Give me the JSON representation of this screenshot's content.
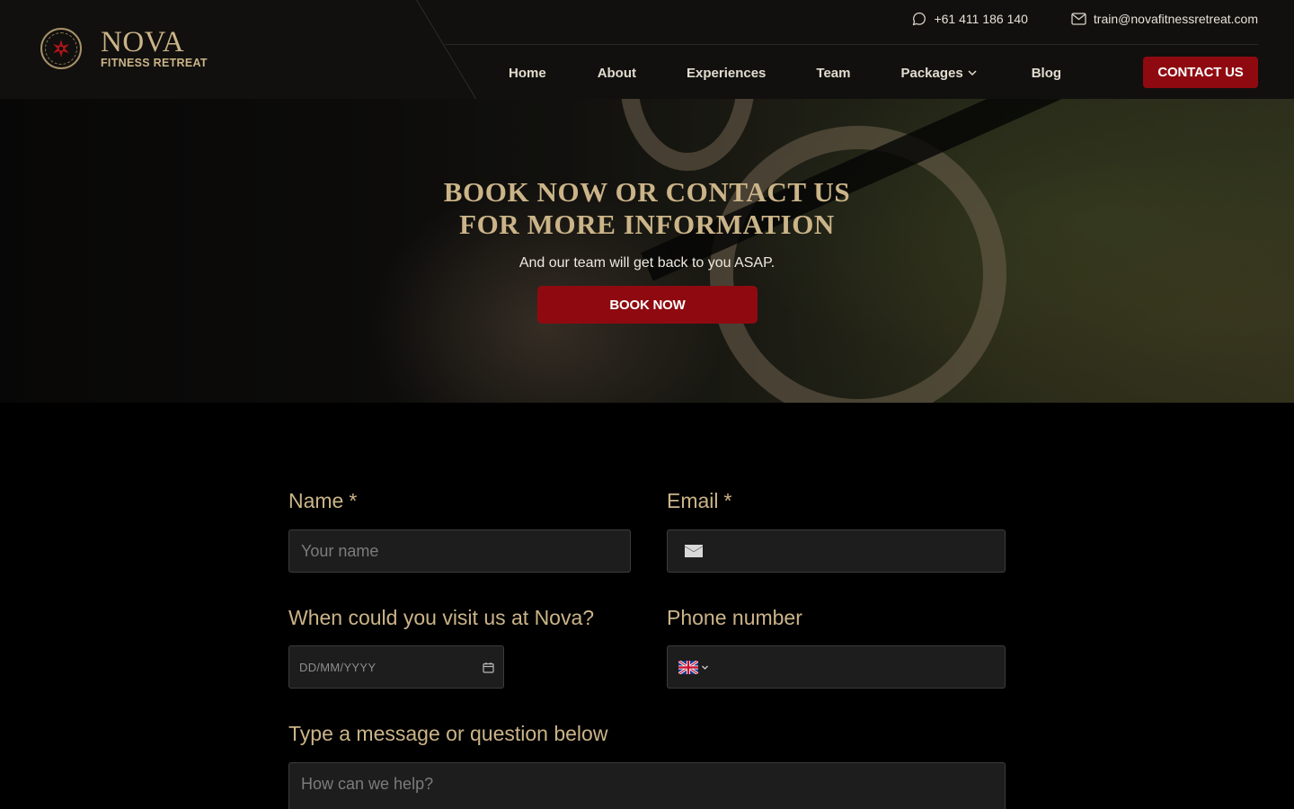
{
  "header": {
    "brand_title": "NOVA",
    "brand_subtitle": "FITNESS RETREAT",
    "phone": "+61 411 186 140",
    "email": "train@novafitnessretreat.com",
    "nav": [
      {
        "label": "Home"
      },
      {
        "label": "About"
      },
      {
        "label": "Experiences"
      },
      {
        "label": "Team"
      },
      {
        "label": "Packages"
      },
      {
        "label": "Blog"
      }
    ],
    "contact_label": "CONTACT US"
  },
  "hero": {
    "title_line1": "BOOK NOW OR CONTACT US",
    "title_line2": "FOR MORE INFORMATION",
    "subtitle": "And our team will get back to you ASAP.",
    "button_label": "BOOK NOW"
  },
  "form": {
    "name_label": "Name",
    "name_required": "*",
    "name_placeholder": "Your name",
    "email_label": "Email",
    "email_required": "*",
    "visit_label": "When could you visit us at Nova?",
    "visit_placeholder": "DD/MM/YYYY",
    "phone_label": "Phone number",
    "message_label": "Type a message or question below",
    "message_placeholder": "How can we help?"
  },
  "colors": {
    "gold": "#cbb488",
    "accent_red": "#8f0a10",
    "header_bg": "#11100e"
  },
  "icons": [
    "logo-emblem",
    "chat-bubble-icon",
    "mail-icon",
    "chevron-down-icon",
    "envelope-icon",
    "calendar-icon",
    "uk-flag-icon"
  ]
}
